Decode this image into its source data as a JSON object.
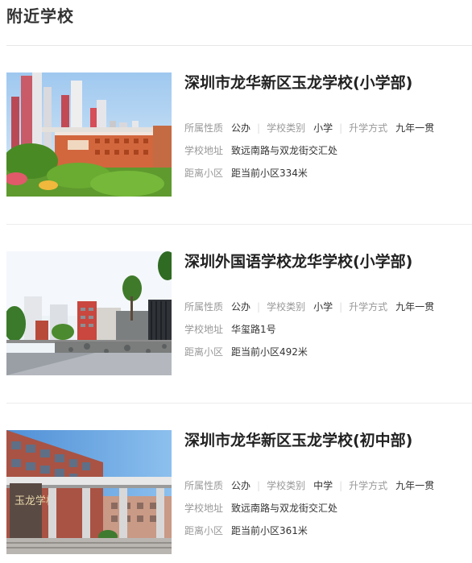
{
  "section_title": "附近学校",
  "labels": {
    "nature": "所属性质",
    "category": "学校类别",
    "mode": "升学方式",
    "address": "学校地址",
    "distance": "距离小区"
  },
  "schools": [
    {
      "name": "深圳市龙华新区玉龙学校(小学部)",
      "nature": "公办",
      "category": "小学",
      "mode": "九年一贯",
      "address": "致远南路与双龙街交汇处",
      "distance": "距当前小区334米"
    },
    {
      "name": "深圳外国语学校龙华学校(小学部)",
      "nature": "公办",
      "category": "小学",
      "mode": "九年一贯",
      "address": "华玺路1号",
      "distance": "距当前小区492米"
    },
    {
      "name": "深圳市龙华新区玉龙学校(初中部)",
      "nature": "公办",
      "category": "中学",
      "mode": "九年一贯",
      "address": "致远南路与双龙街交汇处",
      "distance": "距当前小区361米"
    }
  ],
  "sign_text": "玉龙学校",
  "colors": {
    "title": "#333333",
    "label": "#999999",
    "value": "#333333",
    "divider": "#ececec"
  }
}
